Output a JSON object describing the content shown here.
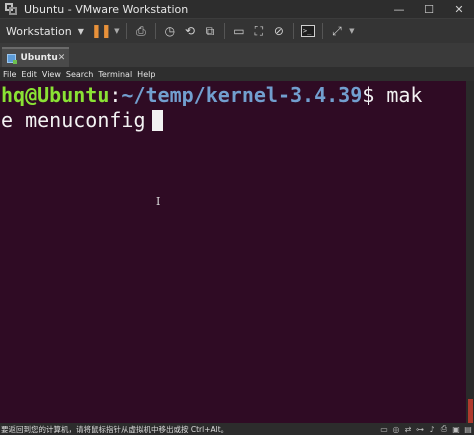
{
  "window": {
    "title": "Ubuntu - VMware Workstation",
    "minimize": "—",
    "maximize": "☐",
    "close": "✕"
  },
  "toolbar": {
    "workstation_label": "Workstation",
    "icons": [
      "pause-icon",
      "send-keys-icon",
      "snapshot-icon",
      "revert-snapshot-icon",
      "manage-snapshots-icon",
      "fit-guest-icon",
      "unity-icon",
      "console-view-icon",
      "full-screen-icon"
    ]
  },
  "tab": {
    "label": "Ubuntu",
    "close": "✕"
  },
  "terminal_menu": [
    "File",
    "Edit",
    "View",
    "Search",
    "Terminal",
    "Help"
  ],
  "terminal": {
    "prompt_user": "hq@Ubuntu",
    "prompt_sep": ":",
    "prompt_path": "~/temp/kernel-3.4.39",
    "prompt_dollar": "$",
    "command_line1": " mak",
    "command_line2": "e menuconfig",
    "ibeam": "I"
  },
  "statusbar": {
    "text": "要返回到您的计算机，请将鼠标指针从虚拟机中移出或按 Ctrl+Alt。"
  },
  "colors": {
    "terminal_bg": "#2f0b24",
    "prompt_user": "#8ae234",
    "prompt_path": "#729fcf",
    "pause_accent": "#e8913a"
  }
}
